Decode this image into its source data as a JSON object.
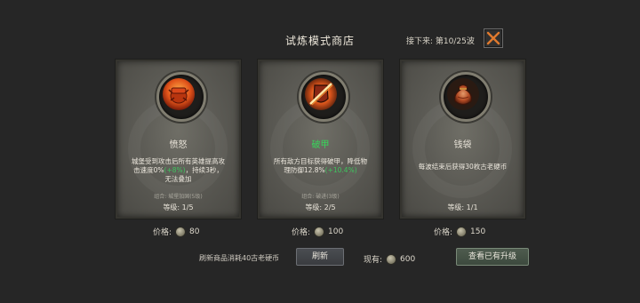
{
  "header": {
    "title": "试炼模式商店",
    "wave": "接下来: 第10/25波"
  },
  "cards": [
    {
      "icon": "rage-fist-icon",
      "name": "愤怒",
      "desc_a": "城堡受到攻击后所有英雄提高攻",
      "desc_b": "击速度0%",
      "desc_hl": "(+8%)",
      "desc_c": "，持续3秒，",
      "desc_d": "无法叠加",
      "combo": "组合: 城堡加固(5级)",
      "level": "等级: 1/5",
      "price_label": "价格:",
      "price": "80"
    },
    {
      "icon": "armor-break-icon",
      "name": "破甲",
      "desc_a": "所有敌方目标获得破甲，降低物",
      "desc_b": "理防御12.8%",
      "desc_hl": "(+10.4%)",
      "desc_c": "",
      "desc_d": "",
      "combo": "组合: 破进(3级)",
      "level": "等级: 2/5",
      "price_label": "价格:",
      "price": "100"
    },
    {
      "icon": "money-bag-icon",
      "name": "钱袋",
      "desc_a": "每波结束后获得30枚古老硬币",
      "desc_b": "",
      "desc_hl": "",
      "desc_c": "",
      "desc_d": "",
      "combo": "",
      "level": "等级: 1/1",
      "price_label": "价格:",
      "price": "150"
    }
  ],
  "footer": {
    "refresh_note": "刷新商品消耗40古老硬币",
    "refresh_button": "刷新",
    "owned_label": "现有:",
    "owned_value": "600",
    "upgrades_button": "查看已有升级"
  }
}
